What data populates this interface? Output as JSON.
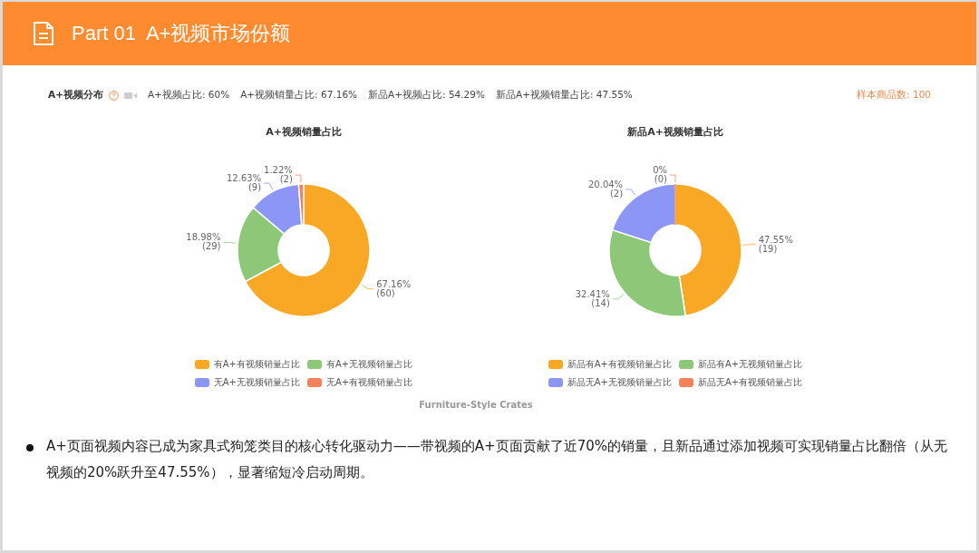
{
  "header": {
    "title": "Part 01  A+视频市场份额"
  },
  "stats_bar": {
    "title": "A+视频分布",
    "stats": [
      "A+视频占比: 60%",
      "A+视频销量占比: 67.16%",
      "新品A+视频占比: 54.29%",
      "新品A+视频销量占比: 47.55%"
    ],
    "sample_count": "样本商品数: 100"
  },
  "charts": [
    {
      "chart_data": {
        "type": "donut",
        "title": "A+视频销量占比",
        "categories": [
          "有A+有视频销量占比",
          "有A+无视频销量占比",
          "无A+无视频销量占比",
          "无A+有视频销量占比"
        ],
        "colors": [
          "#f8a825",
          "#8cc878",
          "#8c96f5",
          "#f5825a"
        ],
        "series": [
          {
            "values": [
              67.16,
              18.98,
              12.63,
              1.22
            ]
          }
        ],
        "value_labels": [
          [
            "67.16%",
            "(60)"
          ],
          [
            "18.98%",
            "(29)"
          ],
          [
            "12.63%",
            "(9)"
          ],
          [
            "1.22%",
            "(2)"
          ]
        ],
        "legend": "bottom"
      }
    },
    {
      "chart_data": {
        "type": "donut",
        "title": "新品A+视频销量占比",
        "categories": [
          "新品有A+有视频销量占比",
          "新品有A+无视频销量占比",
          "新品无A+无视频销量占比",
          "新品无A+有视频销量占比"
        ],
        "colors": [
          "#f8a825",
          "#8cc878",
          "#8c96f5",
          "#f5825a"
        ],
        "series": [
          {
            "values": [
              47.55,
              32.41,
              20.04,
              0
            ]
          }
        ],
        "value_labels": [
          [
            "47.55%",
            "(19)"
          ],
          [
            "32.41%",
            "(14)"
          ],
          [
            "20.04%",
            "(2)"
          ],
          [
            "0%",
            "(0)"
          ]
        ],
        "legend": "bottom"
      }
    }
  ],
  "category": "Furniture-Style Crates",
  "summary": "A+页面视频内容已成为家具式狗笼类目的核心转化驱动力——带视频的A+页面贡献了近70%的销量，且新品通过添加视频可实现销量占比翻倍（从无视频的20%跃升至47.55%），显著缩短冷启动周期。"
}
